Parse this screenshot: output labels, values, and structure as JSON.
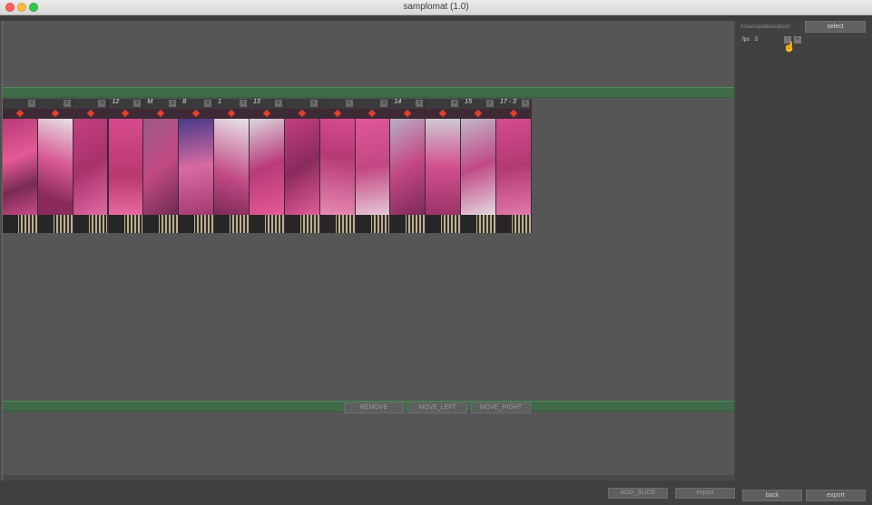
{
  "window": {
    "title": "samplomat (1.0)"
  },
  "sidebar": {
    "path": "/Users/andreasbisch",
    "select_label": "select",
    "fps_label": "fps",
    "fps_value": "5",
    "minus": "-",
    "plus": "+"
  },
  "toolbar": {
    "remove_label": "REMOVE",
    "move_left_label": "MOVE_LEFT",
    "move_right_label": "MOVE_RIGHT"
  },
  "footer": {
    "add_slice_label": "ADD_SLICE",
    "export_main_label": "export",
    "back_label": "back",
    "export_side_label": "export"
  },
  "frames": [
    {
      "label": ""
    },
    {
      "label": ""
    },
    {
      "label": ""
    },
    {
      "label": "12"
    },
    {
      "label": "M"
    },
    {
      "label": "8"
    },
    {
      "label": "1"
    },
    {
      "label": "13"
    },
    {
      "label": ""
    },
    {
      "label": ""
    },
    {
      "label": ""
    },
    {
      "label": "14"
    },
    {
      "label": ""
    },
    {
      "label": "15"
    },
    {
      "label": "17 - 3"
    }
  ],
  "colors": {
    "accent_green": "#3f6b48",
    "film_pink": "#c83a74",
    "marker_red": "#e0402f"
  }
}
